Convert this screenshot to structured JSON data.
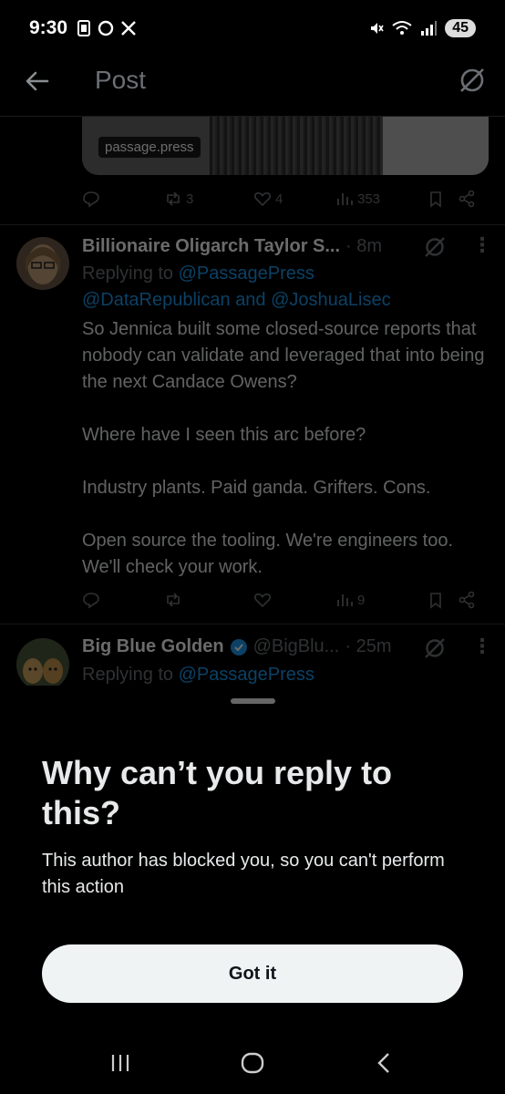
{
  "status_bar": {
    "time": "9:30",
    "battery": "45"
  },
  "header": {
    "title": "Post"
  },
  "top_card": {
    "domain": "passage.press",
    "retweets": "3",
    "likes": "4",
    "views": "353"
  },
  "reply1": {
    "name": "Billionaire Oligarch Taylor S...",
    "time": "· 8m",
    "replying_prefix": "Replying to",
    "mention1": "@PassagePress",
    "mention2": "@DataRepublican",
    "and_text": "and",
    "mention3": "@JoshuaLisec",
    "paragraphs": [
      "So Jennica built some closed-source reports that nobody can validate and leveraged that into being the next Candace Owens?",
      "Where have I seen this arc before?",
      "Industry plants. Paid ganda. Grifters. Cons.",
      "Open source the tooling. We're engineers too. We'll check your work."
    ],
    "views": "9"
  },
  "reply2": {
    "name": "Big Blue Golden",
    "handle": "@BigBlu...",
    "time": "· 25m",
    "replying_prefix": "Replying to",
    "mention1": "@PassagePress"
  },
  "sheet": {
    "title": "Why can’t you reply to this?",
    "description": "This author has blocked you, so you can't perform this action",
    "button": "Got it"
  }
}
